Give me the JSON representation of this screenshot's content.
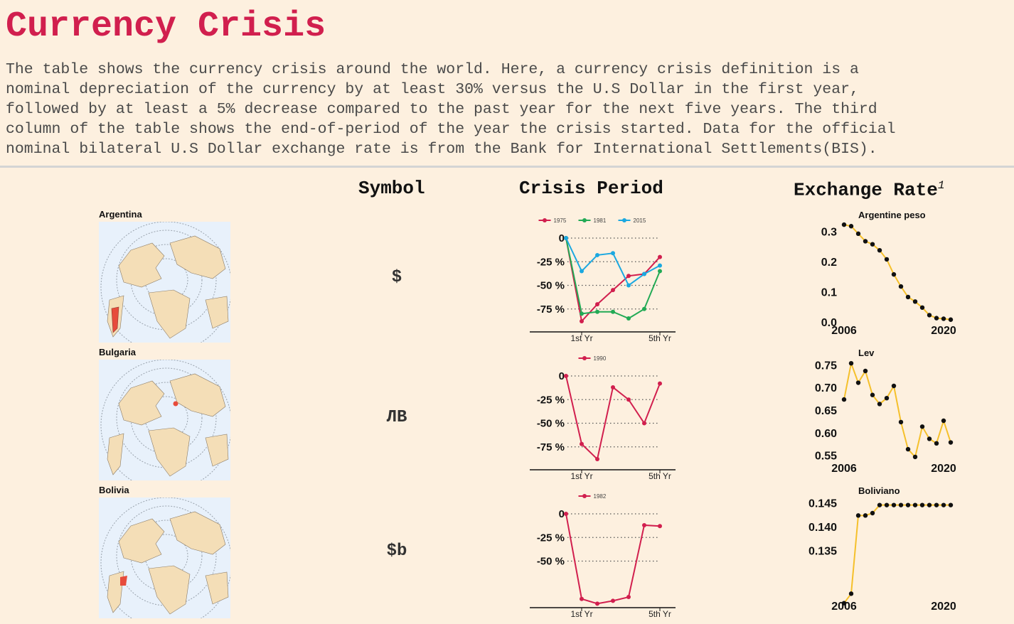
{
  "header": {
    "title": "Currency Crisis",
    "description_lines": [
      "The table shows the currency crisis around the world. Here, a currency crisis definition is a",
      "nominal depreciation of the currency by at least 30% versus the U.S Dollar in the first year,",
      "followed by at least a 5% decrease compared to the past year for the next five years. The third",
      "column of the table shows the end-of-period of the year the crisis started. Data for the official",
      "nominal bilateral U.S Dollar exchange rate is from the Bank for International Settlements(BIS)."
    ]
  },
  "columns": {
    "symbol": "Symbol",
    "crisis_period": "Crisis Period",
    "exchange_rate": "Exchange Rate",
    "exchange_rate_footnote": "1"
  },
  "colors": {
    "accent": "#d11f4e",
    "series_1": "#d11f4e",
    "series_2": "#22aa55",
    "series_3": "#1ba8e0",
    "rate_line": "#f5c02b",
    "rate_point": "#111111",
    "map_ocean": "#e8f1fb",
    "map_land": "#f4deb7",
    "map_highlight": "#e74c3c"
  },
  "rows": [
    {
      "country": "Argentina",
      "symbol": "$",
      "crisis": {
        "type": "line",
        "x_ticks": [
          "1st Yr",
          "5th Yr"
        ],
        "y_ticks": [
          "0",
          "-25 %",
          "-50 %",
          "-75 %"
        ],
        "ylim": [
          -100,
          0
        ],
        "series": [
          {
            "name": "1975",
            "values": [
              0,
              -88,
              -70,
              -55,
              -40,
              -38,
              -20
            ]
          },
          {
            "name": "1981",
            "values": [
              0,
              -80,
              -78,
              -78,
              -85,
              -75,
              -35
            ]
          },
          {
            "name": "2015",
            "values": [
              0,
              -35,
              -18,
              -16,
              -50,
              -38,
              -29
            ]
          }
        ]
      },
      "rate": {
        "type": "scatter-line",
        "title": "Argentine peso",
        "x_ticks": [
          "2006",
          "2020"
        ],
        "y_ticks": [
          "0.3",
          "0.2",
          "0.1",
          "0.0"
        ],
        "ylim": [
          0,
          0.33
        ],
        "x": [
          2006,
          2007,
          2008,
          2009,
          2010,
          2011,
          2012,
          2013,
          2014,
          2015,
          2016,
          2017,
          2018,
          2019,
          2020,
          2021
        ],
        "values": [
          0.325,
          0.32,
          0.295,
          0.27,
          0.26,
          0.24,
          0.21,
          0.16,
          0.12,
          0.085,
          0.07,
          0.05,
          0.025,
          0.015,
          0.013,
          0.01
        ]
      }
    },
    {
      "country": "Bulgaria",
      "symbol": "ЛВ",
      "crisis": {
        "type": "line",
        "x_ticks": [
          "1st Yr",
          "5th Yr"
        ],
        "y_ticks": [
          "0",
          "-25 %",
          "-50 %",
          "-75 %"
        ],
        "ylim": [
          -100,
          0
        ],
        "series": [
          {
            "name": "1990",
            "values": [
              0,
              -72,
              -88,
              -12,
              -25,
              -50,
              -8
            ]
          }
        ]
      },
      "rate": {
        "type": "scatter-line",
        "title": "Lev",
        "x_ticks": [
          "2006",
          "2020"
        ],
        "y_ticks": [
          "0.75",
          "0.70",
          "0.65",
          "0.60",
          "0.55"
        ],
        "ylim": [
          0.54,
          0.76
        ],
        "x": [
          2006,
          2007,
          2008,
          2009,
          2010,
          2011,
          2012,
          2013,
          2014,
          2015,
          2016,
          2017,
          2018,
          2019,
          2020,
          2021
        ],
        "values": [
          0.675,
          0.755,
          0.712,
          0.738,
          0.685,
          0.665,
          0.678,
          0.705,
          0.625,
          0.565,
          0.548,
          0.615,
          0.588,
          0.578,
          0.628,
          0.58
        ]
      }
    },
    {
      "country": "Bolivia",
      "symbol": "$b",
      "crisis": {
        "type": "line",
        "x_ticks": [
          "1st Yr",
          "5th Yr"
        ],
        "y_ticks": [
          "0",
          "-25 %",
          "-50 %"
        ],
        "ylim": [
          -100,
          0
        ],
        "series": [
          {
            "name": "1982",
            "values": [
              0,
              -90,
              -95,
              -92,
              -88,
              -12,
              -13
            ]
          }
        ]
      },
      "rate": {
        "type": "scatter-line",
        "title": "Boliviano",
        "x_ticks": [
          "2006",
          "2020"
        ],
        "y_ticks": [
          "0.145",
          "0.140",
          "0.135"
        ],
        "ylim": [
          0.125,
          0.146
        ],
        "x": [
          2006,
          2007,
          2008,
          2009,
          2010,
          2011,
          2012,
          2013,
          2014,
          2015,
          2016,
          2017,
          2018,
          2019,
          2020,
          2021
        ],
        "values": [
          0.124,
          0.126,
          0.1425,
          0.1425,
          0.143,
          0.1447,
          0.1447,
          0.1447,
          0.1447,
          0.1447,
          0.1447,
          0.1447,
          0.1447,
          0.1447,
          0.1447,
          0.1447
        ]
      }
    }
  ]
}
